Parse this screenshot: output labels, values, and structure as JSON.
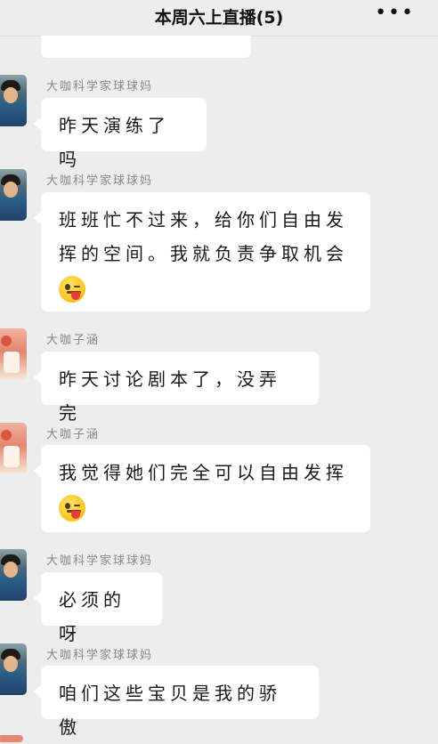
{
  "header": {
    "title": "本周六上直播(5)",
    "more_label": "•••"
  },
  "messages": [
    {
      "sender": "大咖科学家球球妈",
      "text": "昨天演练了吗",
      "emoji": false
    },
    {
      "sender": "大咖科学家球球妈",
      "text": "班班忙不过来，给你们自由发挥的空间。我就负责争取机会",
      "emoji": true
    },
    {
      "sender": "大咖子涵",
      "text": "昨天讨论剧本了，没弄完",
      "emoji": false
    },
    {
      "sender": "大咖子涵",
      "text": "我觉得她们完全可以自由发挥",
      "emoji": true
    },
    {
      "sender": "大咖科学家球球妈",
      "text": "必须的呀",
      "emoji": false
    },
    {
      "sender": "大咖科学家球球妈",
      "text": "咱们这些宝贝是我的骄傲",
      "emoji": false
    }
  ],
  "icons": {
    "emoji": "wink-tongue-emoji",
    "more": "more-dots-icon"
  }
}
